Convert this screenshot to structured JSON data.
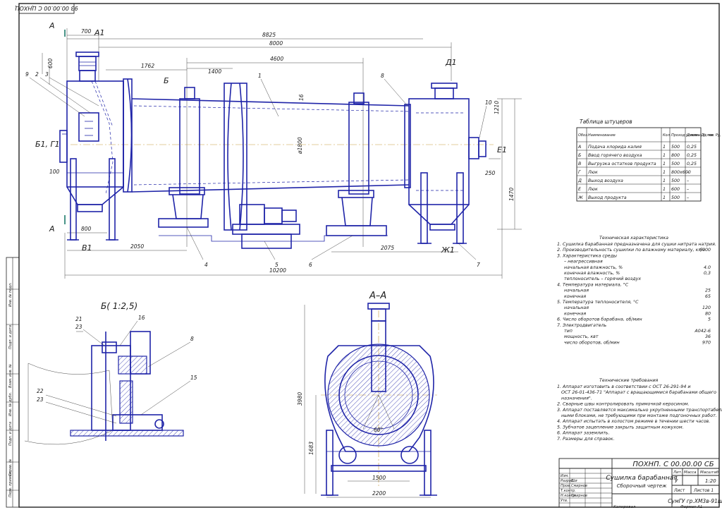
{
  "sheet": {
    "top_code": "93 00.00.00 С ЦНХОЦ",
    "drawing_code": "ПОХНП. С 00.00.00 СБ",
    "title_main": "Сушилка барабанная",
    "title_sub": "Сборочный чертеж",
    "org": "СумГУ гр.ХМ3в-91ш",
    "scale": "1:20",
    "sheet_no": "1",
    "sheets": "Листов 1",
    "mass": "",
    "lit": "У",
    "format": "Формат А1",
    "copied": "Копировал",
    "title_headers": [
      "Лит.",
      "Масса",
      "Масштаб"
    ],
    "sheet_label": "Лист",
    "roles": [
      {
        "role": "Изм.",
        "name": ""
      },
      {
        "role": "Разраб.",
        "name": "Ши"
      },
      {
        "role": "Пров.",
        "name": "Смирнов"
      },
      {
        "role": "Т.контр.",
        "name": ""
      },
      {
        "role": "Н.контр.",
        "name": "Смирнов"
      },
      {
        "role": "Утв.",
        "name": ""
      }
    ],
    "side_stamp": [
      "Перв. примен.",
      "Справ. №",
      "Подп. и дата",
      "Инв. № дубл.",
      "Взам. инв. №",
      "Подп. и дата",
      "Инв. № подл."
    ]
  },
  "main_view": {
    "section_marks": [
      "А",
      "А",
      "А1",
      "Б",
      "Б1, Г1",
      "Д1",
      "Е1",
      "Ж1",
      "В1"
    ],
    "dimensions": [
      "700",
      "8825",
      "8000",
      "1762",
      "1400",
      "4600",
      "600",
      "1210",
      "250",
      "1470",
      "800",
      "100",
      "2050",
      "2075",
      "10200",
      "ø1800",
      "16"
    ],
    "leaders": [
      "9",
      "2",
      "3",
      "1",
      "8",
      "10",
      "4",
      "5",
      "6",
      "7"
    ]
  },
  "view_b": {
    "title": "Б( 1:2,5)",
    "leaders": [
      "21",
      "23",
      "16",
      "8",
      "15",
      "22",
      "23"
    ]
  },
  "view_aa": {
    "title": "А–А",
    "dimensions": [
      "3980",
      "1683",
      "1500",
      "2200",
      "60°"
    ]
  },
  "nozzle_table": {
    "title": "Таблица штуцеров",
    "headers": [
      "Обоз.",
      "Наименование",
      "Кол.",
      "Проход условн. Ду, мм",
      "Давлен. Услов. Ру, МПа"
    ],
    "rows": [
      [
        "А",
        "Подача хлорида калия",
        "1",
        "500",
        "0,25"
      ],
      [
        "Б",
        "Ввод горячего воздуха",
        "1",
        "800",
        "0,25"
      ],
      [
        "В",
        "Выгрузка остатков продукта",
        "1",
        "500",
        "0,25"
      ],
      [
        "Г",
        "Люк",
        "1",
        "800х600",
        "–"
      ],
      [
        "Д",
        "Выход воздуха",
        "1",
        "500",
        "–"
      ],
      [
        "Е",
        "Люк",
        "1",
        "600",
        "–"
      ],
      [
        "Ж",
        "Выход продукта",
        "1",
        "500",
        "–"
      ]
    ]
  },
  "tech_char": {
    "title": "Техническая характеристика",
    "lines": [
      {
        "text": "1. Сушилка барабанная предназначена для сушки нитрата натрия.",
        "val": ""
      },
      {
        "text": "2. Производительность сушилки по влажному материалу, кг/ч",
        "val": "6000"
      },
      {
        "text": "3. Характеристика среды",
        "val": ""
      },
      {
        "text": "– неагрессивная",
        "val": ""
      },
      {
        "text": "начальная влажность, %",
        "val": "4.0"
      },
      {
        "text": "конечная влажность, %",
        "val": "0,3"
      },
      {
        "text": "теплоноситель – горячий воздух",
        "val": ""
      },
      {
        "text": "4. Температура материала, °С",
        "val": ""
      },
      {
        "text": "начальная",
        "val": "25"
      },
      {
        "text": "конечная",
        "val": "65"
      },
      {
        "text": "5. Температура теплоносителя, °С",
        "val": ""
      },
      {
        "text": "начальная",
        "val": "120"
      },
      {
        "text": "конечная",
        "val": "80"
      },
      {
        "text": "6. Число оборотов барабана, об/мин",
        "val": "5"
      },
      {
        "text": "7. Электродвигатель",
        "val": ""
      },
      {
        "text": "тип",
        "val": "А042-6"
      },
      {
        "text": "мощность, квт",
        "val": "36"
      },
      {
        "text": "число оборотов, об/мин",
        "val": "970"
      }
    ]
  },
  "tech_req": {
    "title": "Технические требования",
    "lines": [
      "1. Аппарат изготовить в соответствии с ОСТ 26-291-94 и",
      "ОСТ 26-01-436-71 \"Аппарат с вращающимися барабанами общего",
      "назначения\".",
      "2. Сварные швы контролировать примочкой керосином.",
      "3. Аппарат поставляется максимально укрупненными транспортабель-",
      "ными блоками, не требующими при монтаже подгоночных работ.",
      "4. Аппарат испытать в холостом режиме в течении шести часов.",
      "5. Зубчатое зацепление закрыть защитным кожухом.",
      "6. Аппарат заземлить.",
      "7. Размеры для справок."
    ]
  }
}
